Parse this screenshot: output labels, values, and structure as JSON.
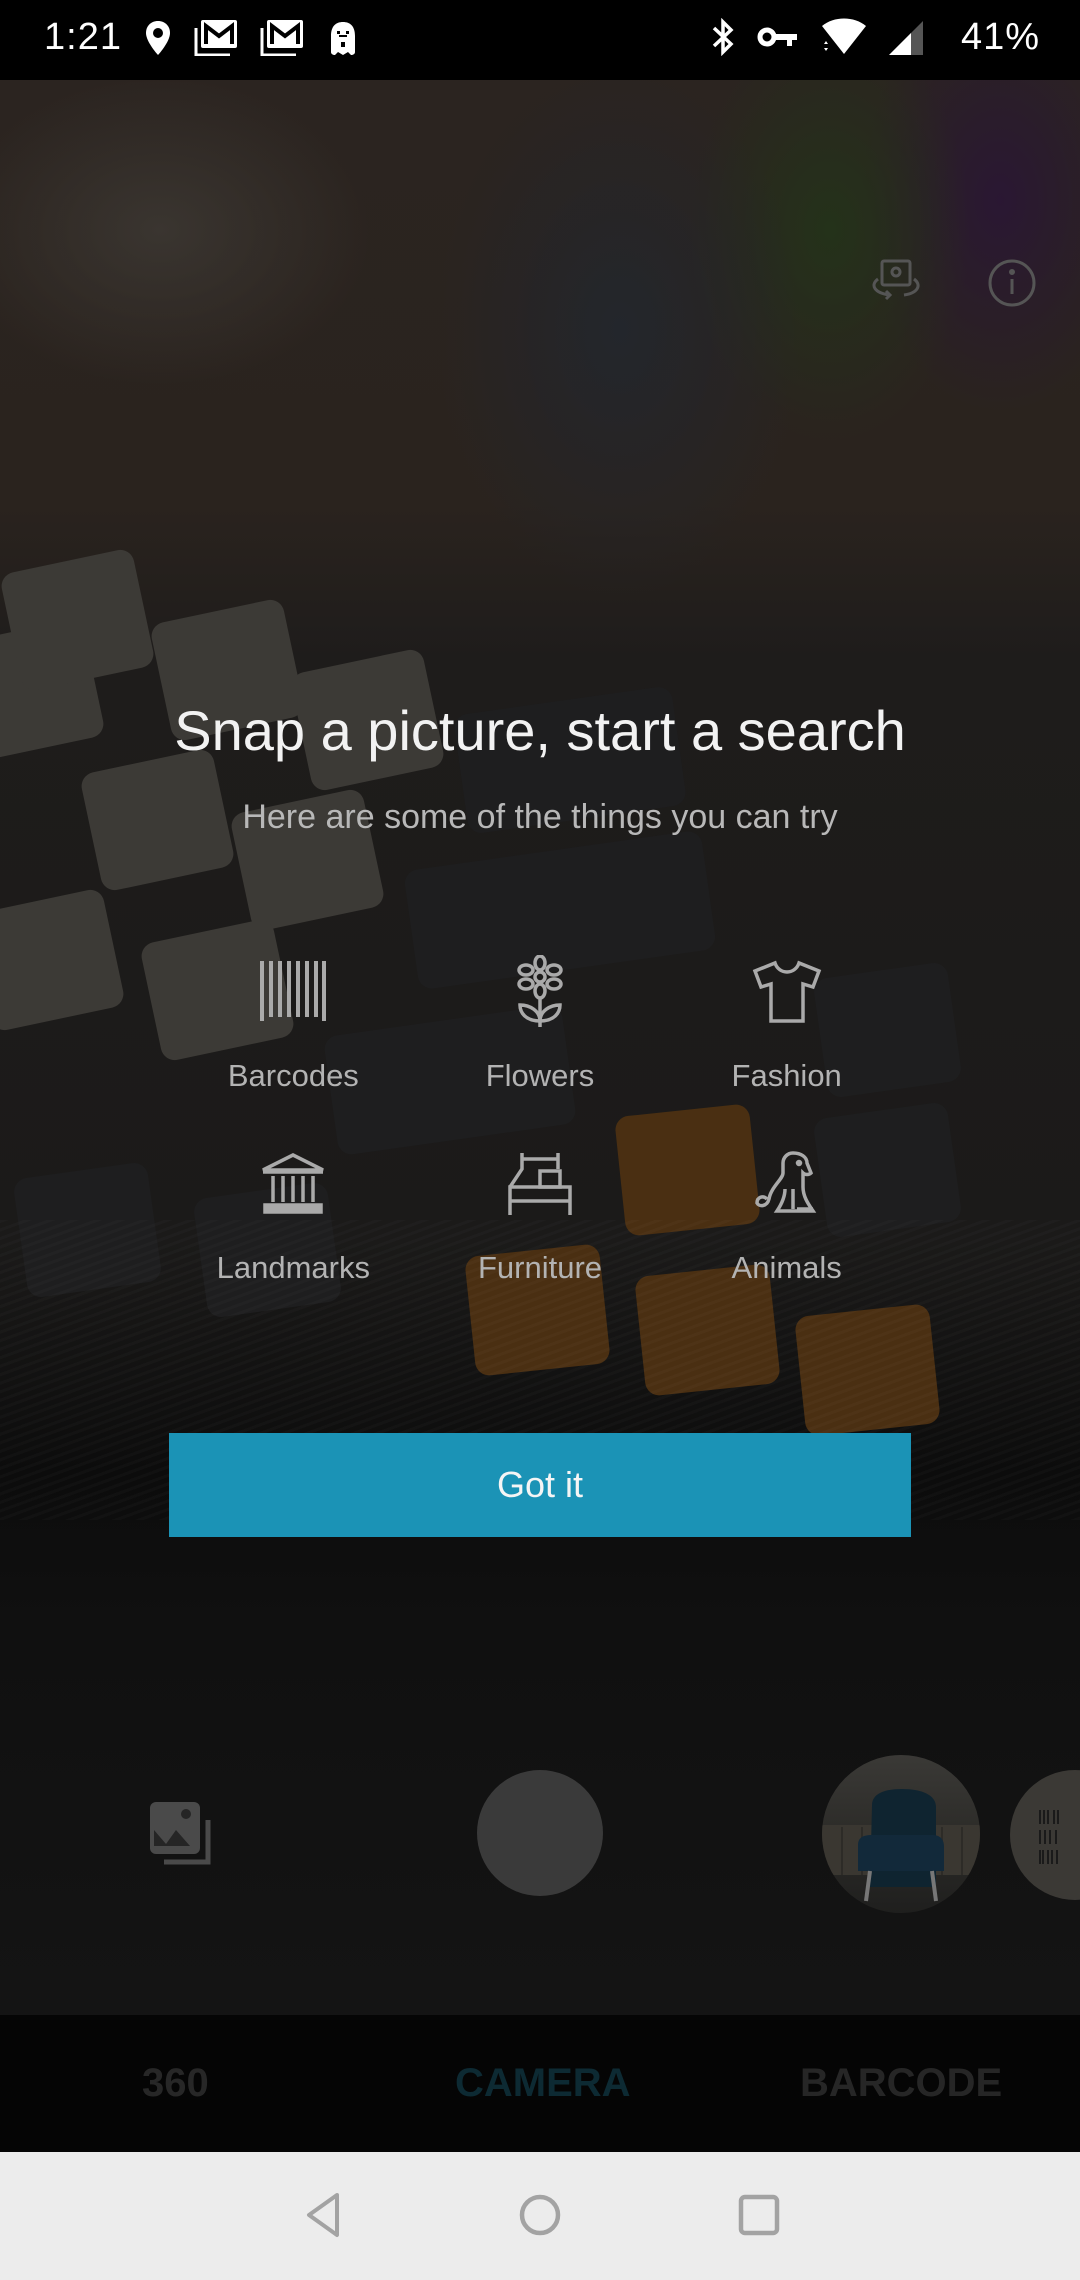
{
  "status_bar": {
    "time": "1:21",
    "battery": "41%",
    "left_icons": [
      "location-icon",
      "gmail-icon",
      "gmail-icon",
      "vpn-lock-icon"
    ],
    "right_icons": [
      "bluetooth-icon",
      "vpn-key-icon",
      "wifi-icon",
      "cell-signal-icon"
    ]
  },
  "camera": {
    "top_actions": [
      {
        "name": "switch-camera",
        "icon": "flip-camera-icon"
      },
      {
        "name": "info",
        "icon": "info-icon"
      }
    ]
  },
  "onboarding": {
    "title": "Snap a picture, start a search",
    "subtitle": "Here are some of the things you can try",
    "categories": [
      {
        "label": "Barcodes",
        "icon": "barcode-icon"
      },
      {
        "label": "Flowers",
        "icon": "flower-icon"
      },
      {
        "label": "Fashion",
        "icon": "tshirt-icon"
      },
      {
        "label": "Landmarks",
        "icon": "landmark-icon"
      },
      {
        "label": "Furniture",
        "icon": "furniture-bed-icon"
      },
      {
        "label": "Animals",
        "icon": "dog-icon"
      }
    ],
    "confirm_label": "Got it",
    "accent_color": "#1b93b6"
  },
  "controls": {
    "gallery_icon": "gallery-icon",
    "shutter": "shutter-button",
    "suggestions": [
      "chair-thumbnail",
      "barcode-thumbnail"
    ]
  },
  "modes": {
    "tabs": [
      "360",
      "CAMERA",
      "BARCODE"
    ],
    "active": "CAMERA"
  },
  "nav": {
    "buttons": [
      "back",
      "home",
      "recents"
    ]
  }
}
